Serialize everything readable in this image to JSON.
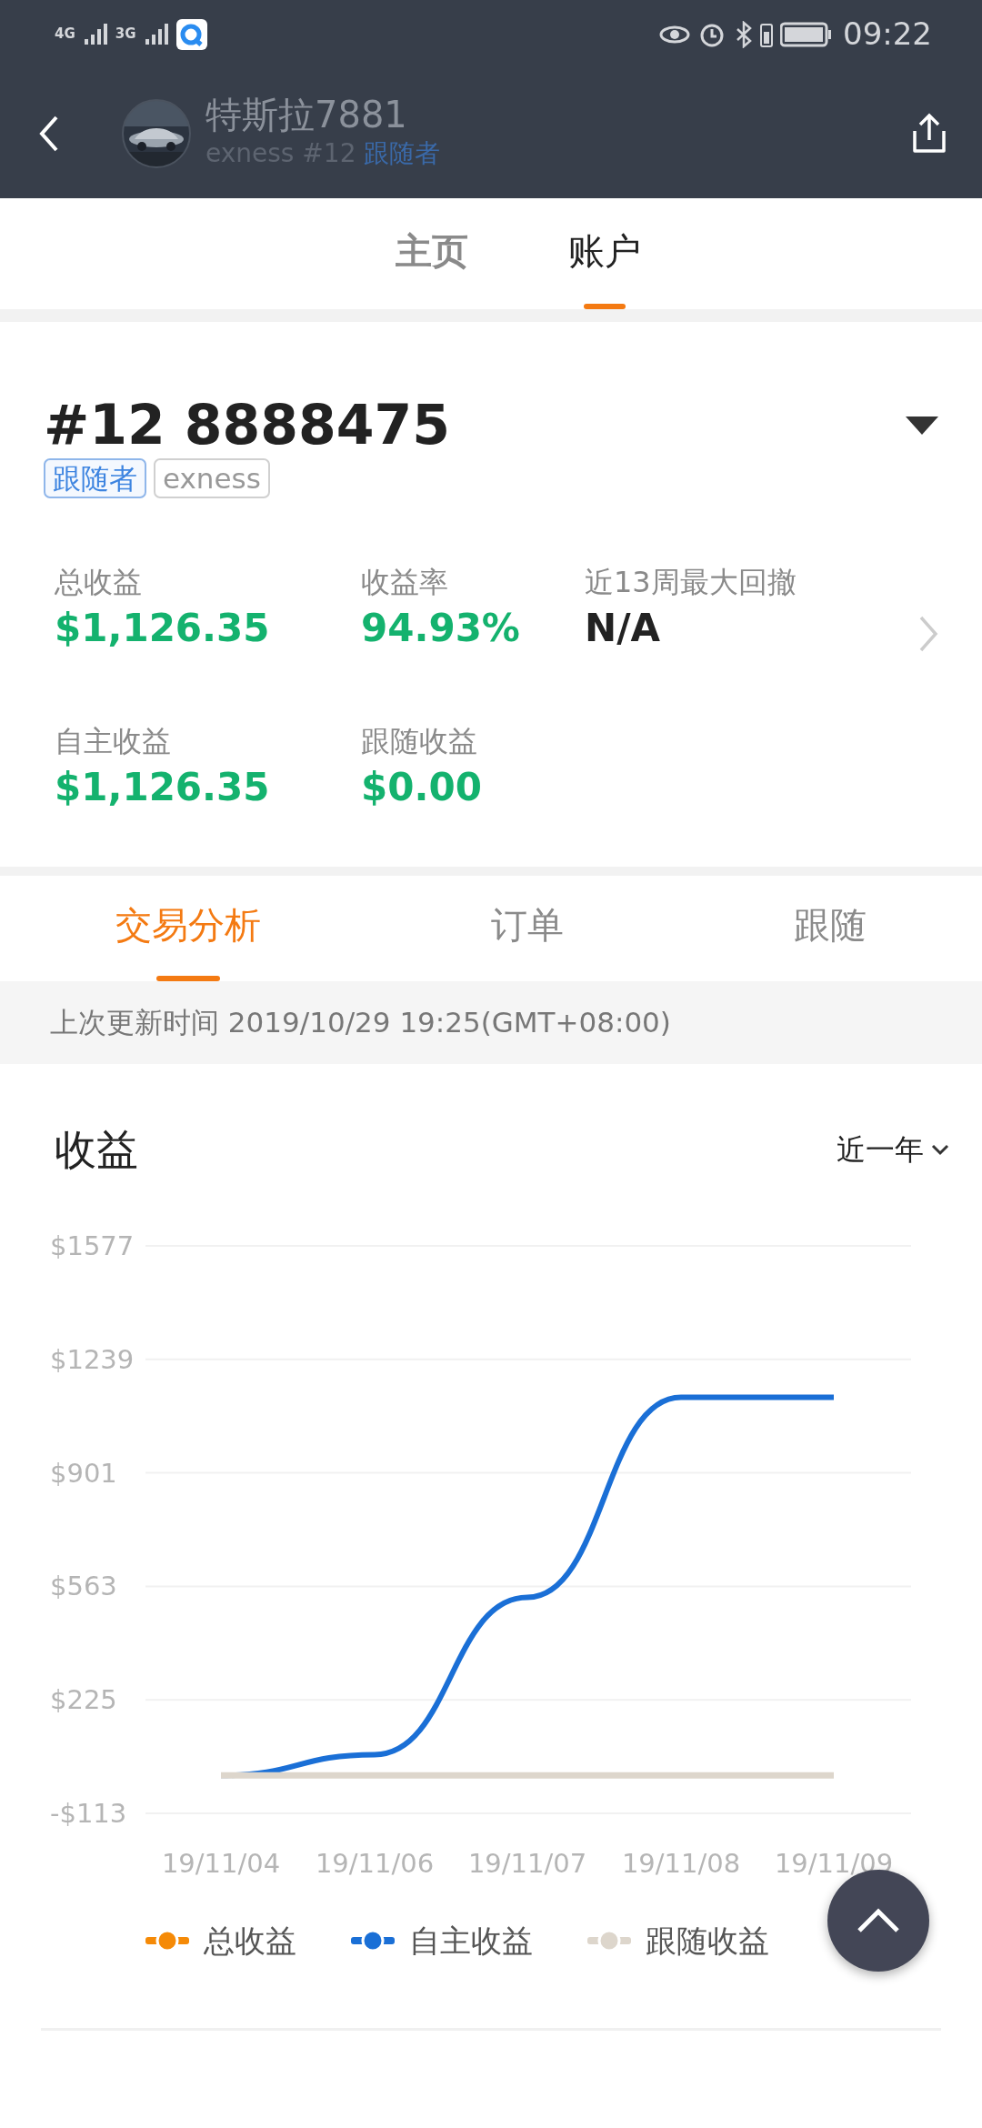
{
  "status_bar": {
    "network_1": "4G",
    "network_2": "3G",
    "time": "09:22"
  },
  "header": {
    "name": "特斯拉7881",
    "broker": "exness #12",
    "role": "跟随者"
  },
  "top_tabs": [
    {
      "label": "主页",
      "selected": false
    },
    {
      "label": "账户",
      "selected": true
    }
  ],
  "account": {
    "number": "#12 8888475",
    "tags": [
      {
        "label": "跟随者",
        "kind": "role"
      },
      {
        "label": "exness",
        "kind": "broker"
      }
    ],
    "stats": [
      {
        "label": "总收益",
        "value": "$1,126.35",
        "kind": "gain"
      },
      {
        "label": "收益率",
        "value": "94.93%",
        "kind": "gain"
      },
      {
        "label": "近13周最大回撤",
        "value": "N/A",
        "kind": "plain"
      },
      {
        "label": "自主收益",
        "value": "$1,126.35",
        "kind": "gain"
      },
      {
        "label": "跟随收益",
        "value": "$0.00",
        "kind": "gain"
      }
    ]
  },
  "sub_tabs": [
    {
      "label": "交易分析",
      "selected": true
    },
    {
      "label": "订单",
      "selected": false
    },
    {
      "label": "跟随",
      "selected": false
    }
  ],
  "update_info": "上次更新时间 2019/10/29 19:25(GMT+08:00)",
  "earnings": {
    "title": "收益",
    "period": "近一年",
    "chart_data": {
      "type": "line",
      "categories": [
        "19/11/04",
        "19/11/06",
        "19/11/07",
        "19/11/08",
        "19/11/09"
      ],
      "grid": true,
      "series": [
        {
          "name": "总收益",
          "color": "#f58a07",
          "values": [
            null,
            null,
            null,
            null,
            null
          ]
        },
        {
          "name": "自主收益",
          "color": "#1a6fd6",
          "values": [
            0,
            62,
            530,
            1126,
            1126
          ]
        },
        {
          "name": "跟随收益",
          "color": "#ddd6cc",
          "values": [
            0,
            0,
            0,
            0,
            0
          ]
        }
      ],
      "ylim": [
        -113,
        1577
      ],
      "yticks": [
        {
          "value": -113,
          "label": "-$113"
        },
        {
          "value": 225,
          "label": "$225"
        },
        {
          "value": 563,
          "label": "$563"
        },
        {
          "value": 901,
          "label": "$901"
        },
        {
          "value": 1239,
          "label": "$1239"
        },
        {
          "value": 1577,
          "label": "$1577"
        }
      ]
    }
  }
}
